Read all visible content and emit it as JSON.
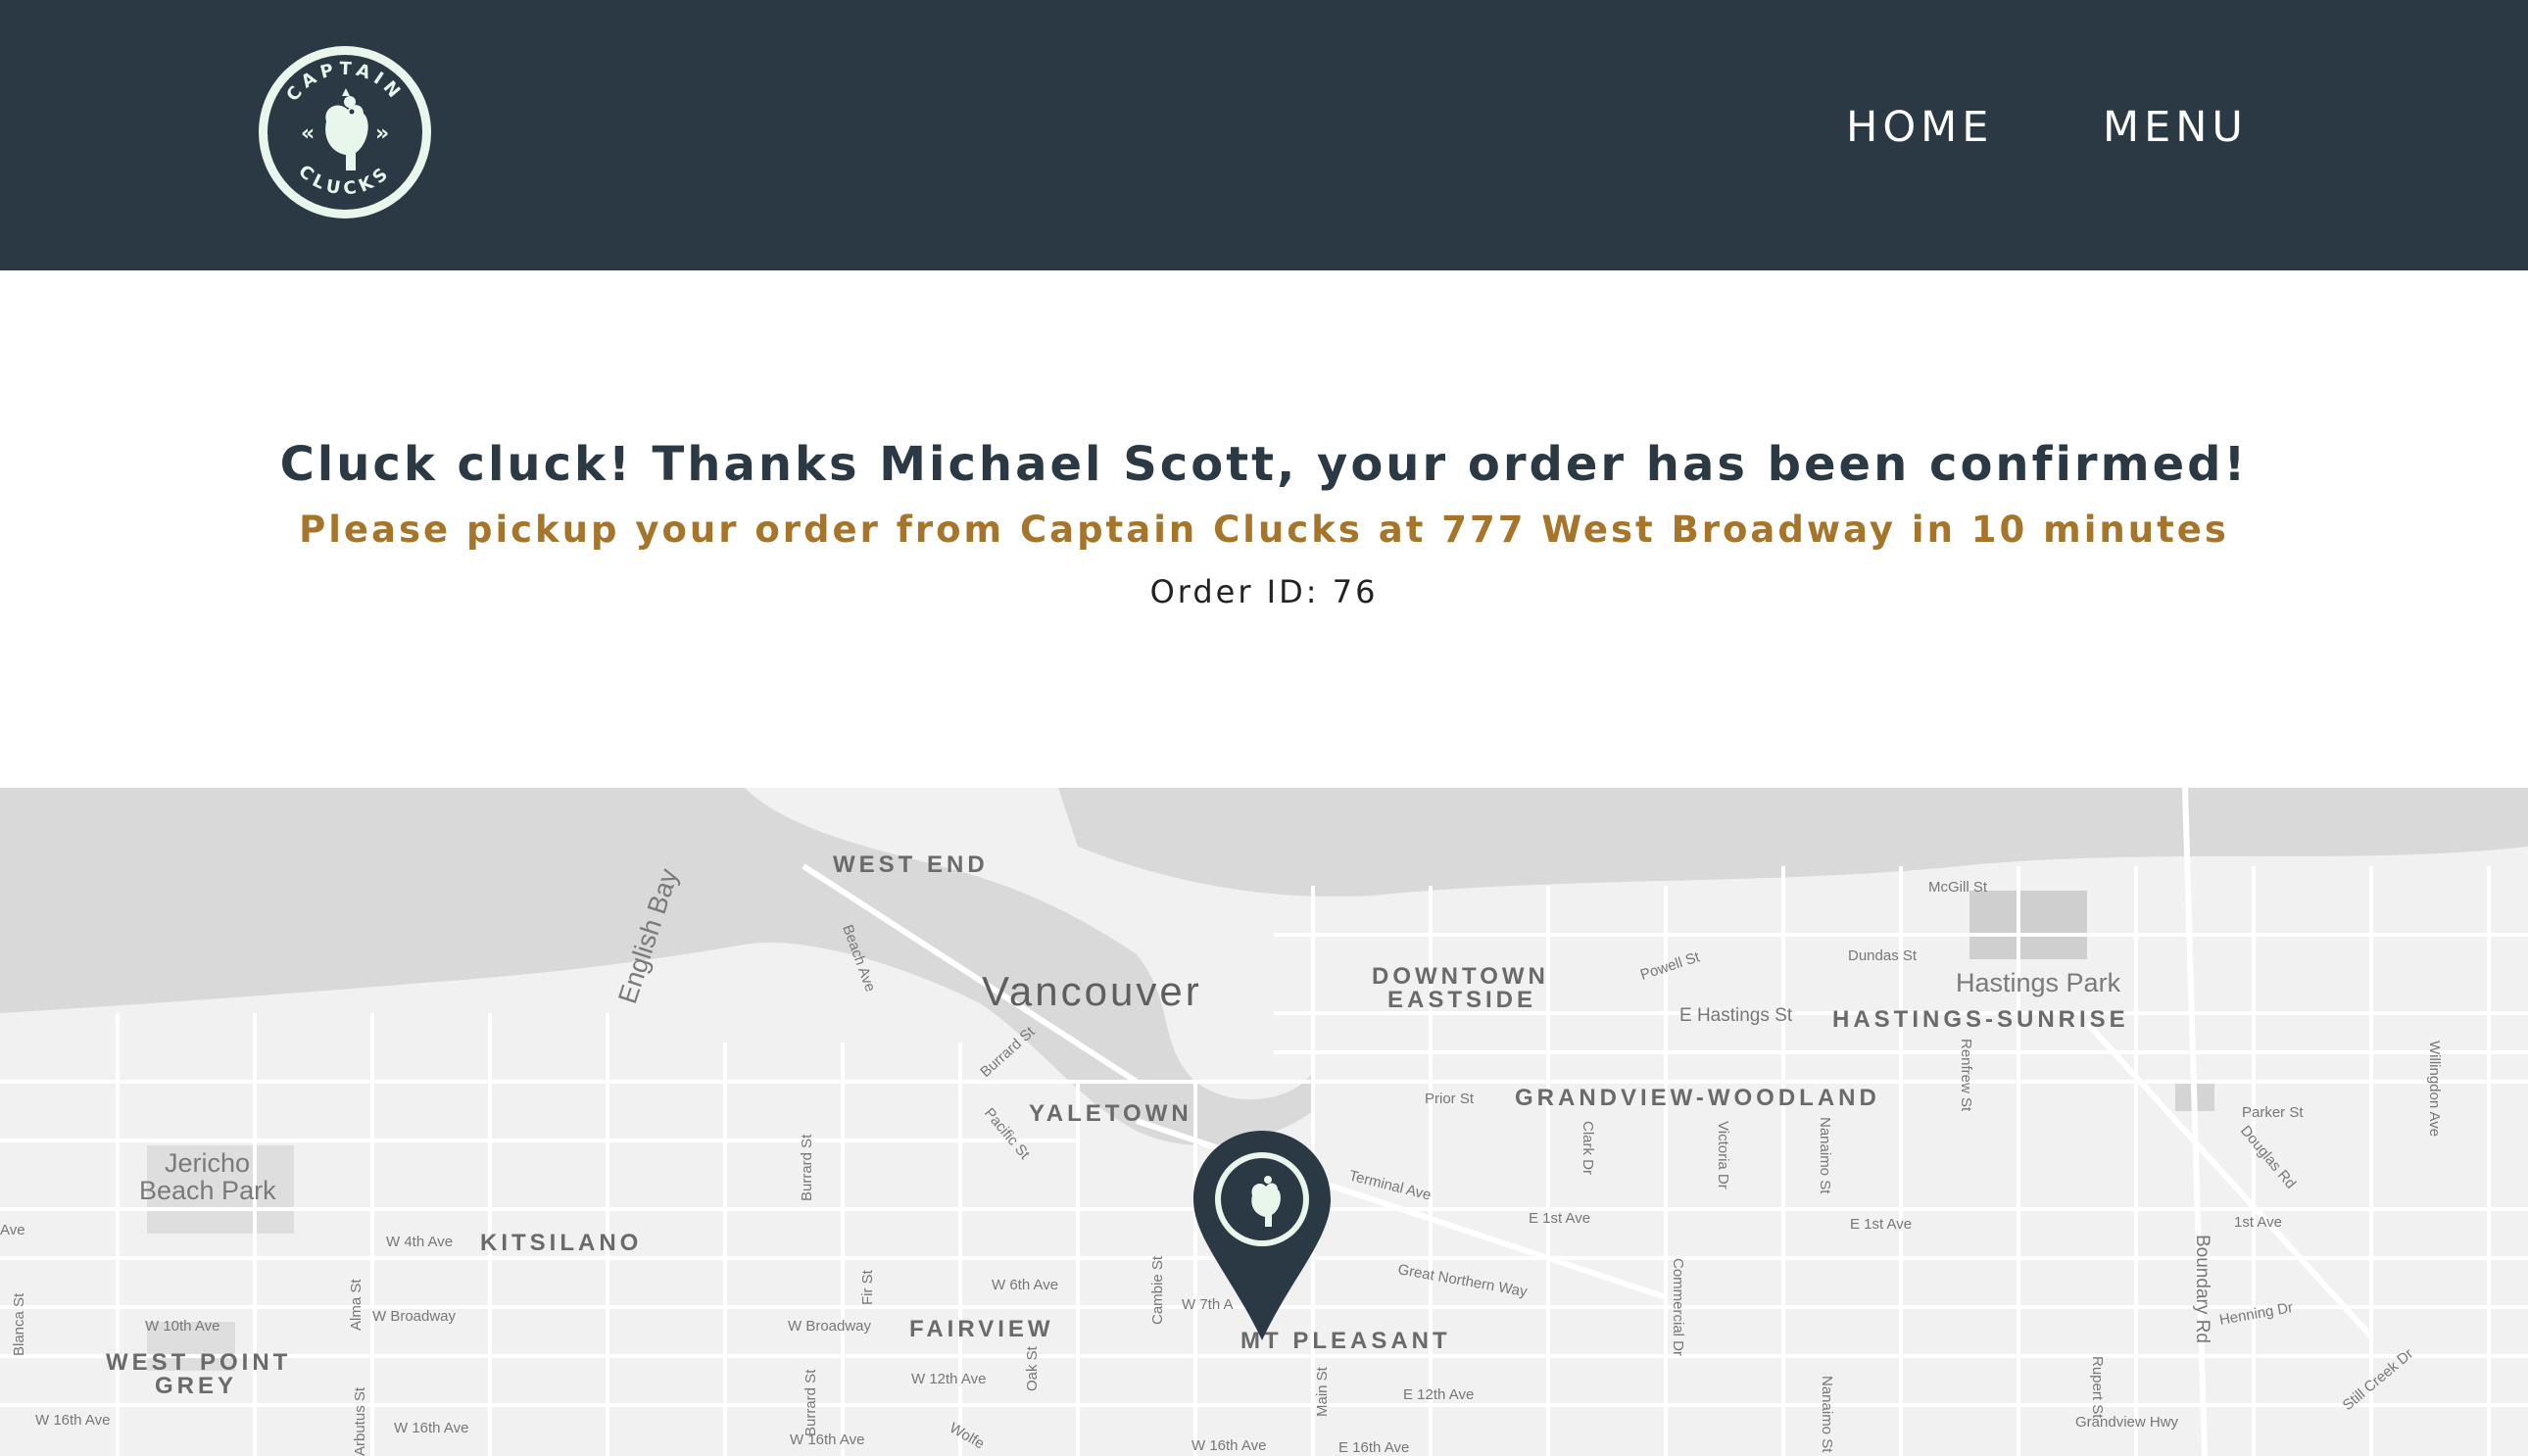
{
  "header": {
    "logo_alt": "Captain Clucks",
    "logo_text_top": "CAPTAIN",
    "logo_text_bottom": "CLUCKS",
    "nav": {
      "home_label": "HOME",
      "menu_label": "MENU"
    },
    "background_color": "#2a3943"
  },
  "confirmation": {
    "title": "Cluck cluck! Thanks Michael Scott, your order has been confirmed!",
    "pickup_message": "Please pickup your order from Captain Clucks at 777 West Broadway in 10 minutes",
    "order_id_label": "Order ID: 76",
    "title_color": "#2a3943",
    "pickup_color": "#a7752a"
  },
  "map": {
    "marker_icon": "captain-clucks-map-pin-icon",
    "neighbourhoods": [
      "WEST END",
      "DOWNTOWN",
      "EASTSIDE",
      "HASTINGS-SUNRISE",
      "GRANDVIEW-WOODLAND",
      "YALETOWN",
      "KITSILANO",
      "FAIRVIEW",
      "MT PLEASANT",
      "WEST POINT",
      "GREY"
    ],
    "city": "Vancouver",
    "parks": [
      "Hastings Park",
      "Jericho",
      "Beach Park"
    ],
    "water": [
      "English Bay"
    ],
    "streets": [
      "McGill St",
      "Dundas St",
      "Powell St",
      "E Hastings St",
      "Beach Ave",
      "Burrard St",
      "Pacific St",
      "Prior St",
      "Renfrew St",
      "Willingdon Ave",
      "Parker St",
      "Douglas Rd",
      "Clark Dr",
      "Victoria Dr",
      "Nanaimo St",
      "Terminal Ave",
      "E 1st Ave",
      "E 1st Ave",
      "1st Ave",
      "W 4th Ave",
      "Burrard St",
      "Ave",
      "Fir St",
      "Cambie St",
      "W 6th Ave",
      "W 7th A",
      "Great Northern Way",
      "Commercial Dr",
      "Boundary Rd",
      "Henning Dr",
      "Alma St",
      "W Broadway",
      "W 10th Ave",
      "W Broadway",
      "Blanca St",
      "Oak St",
      "W 12th Ave",
      "Main St",
      "E 12th Ave",
      "Rupert St",
      "Still Creek Dr",
      "W 16th Ave",
      "W 16th Ave",
      "Burrard St",
      "Arbutus St",
      "W 16th Ave",
      "Wolfe",
      "W 16th Ave",
      "E 16th Ave",
      "Nanaimo St",
      "Grandview Hwy"
    ]
  }
}
